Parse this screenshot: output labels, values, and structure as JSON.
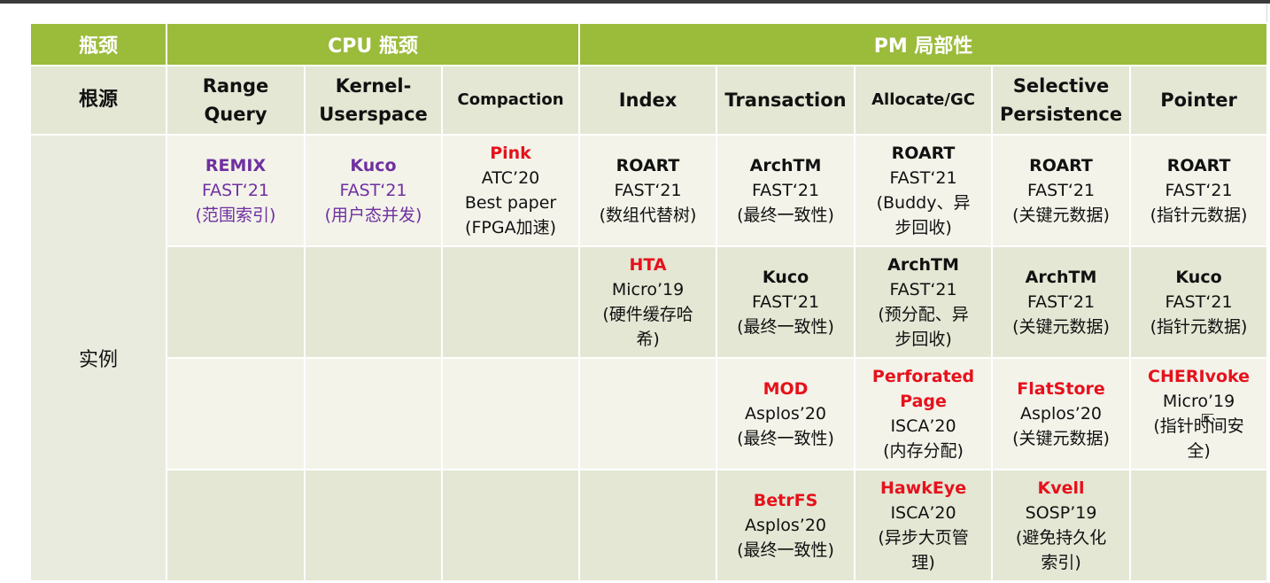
{
  "header": {
    "col0": "瓶颈",
    "cpu": "CPU 瓶颈",
    "pm": "PM 局部性"
  },
  "subheader": {
    "root": "根源",
    "range_query": [
      "Range",
      "Query"
    ],
    "kernel_userspace": [
      "Kernel-",
      "Userspace"
    ],
    "compaction": "Compaction",
    "index": "Index",
    "transaction": "Transaction",
    "allocate_gc": "Allocate/GC",
    "selective_persistence": [
      "Selective",
      "Persistence"
    ],
    "pointer": "Pointer"
  },
  "row_label": "实例",
  "rows": [
    [
      {
        "name": "REMIX",
        "lines": [
          "FAST‘21",
          "(范围索引)"
        ],
        "color": "purple"
      },
      {
        "name": "Kuco",
        "lines": [
          "FAST‘21",
          "(用户态并发)"
        ],
        "color": "purple"
      },
      {
        "name": "Pink",
        "lines": [
          "ATC’20",
          "Best paper",
          "(FPGA加速)"
        ],
        "color": "red"
      },
      {
        "name": "ROART",
        "lines": [
          "FAST‘21",
          "(数组代替树)"
        ],
        "color": "black"
      },
      {
        "name": "ArchTM",
        "lines": [
          "FAST‘21",
          "(最终一致性)"
        ],
        "color": "black"
      },
      {
        "name": "ROART",
        "lines": [
          "FAST‘21",
          "(Buddy、异",
          "步回收)"
        ],
        "color": "black"
      },
      {
        "name": "ROART",
        "lines": [
          "FAST‘21",
          "(关键元数据)"
        ],
        "color": "black"
      },
      {
        "name": "ROART",
        "lines": [
          "FAST‘21",
          "(指针元数据)"
        ],
        "color": "black"
      }
    ],
    [
      null,
      null,
      null,
      {
        "name": "HTA",
        "lines": [
          "Micro’19",
          "(硬件缓存哈",
          "希)"
        ],
        "color": "red"
      },
      {
        "name": "Kuco",
        "lines": [
          "FAST‘21",
          "(最终一致性)"
        ],
        "color": "black"
      },
      {
        "name": "ArchTM",
        "lines": [
          "FAST‘21",
          "(预分配、异",
          "步回收)"
        ],
        "color": "black"
      },
      {
        "name": "ArchTM",
        "lines": [
          "FAST‘21",
          "(关键元数据)"
        ],
        "color": "black"
      },
      {
        "name": "Kuco",
        "lines": [
          "FAST‘21",
          "(指针元数据)"
        ],
        "color": "black"
      }
    ],
    [
      null,
      null,
      null,
      null,
      {
        "name": "MOD",
        "lines": [
          "Asplos’20",
          "(最终一致性)"
        ],
        "color": "red"
      },
      {
        "name_lines": [
          "Perforated",
          "Page"
        ],
        "lines": [
          "ISCA’20",
          "(内存分配)"
        ],
        "color": "red"
      },
      {
        "name": "FlatStore",
        "lines": [
          "Asplos’20",
          "(关键元数据)"
        ],
        "color": "red"
      },
      {
        "name": "CHERIvoke",
        "lines": [
          "Micro’19",
          "(指针时间安",
          "全)"
        ],
        "color": "red"
      }
    ],
    [
      null,
      null,
      null,
      null,
      {
        "name": "BetrFS",
        "lines": [
          "Asplos’20",
          "(最终一致性)"
        ],
        "color": "red"
      },
      {
        "name": "HawkEye",
        "lines": [
          "ISCA’20",
          "(异步大页管",
          "理)"
        ],
        "color": "red"
      },
      {
        "name": "Kvell",
        "lines": [
          "SOSP’19",
          "(避免持久化",
          "索引)"
        ],
        "color": "red"
      },
      null
    ]
  ],
  "colors": {
    "header_green": "#9bbb3b",
    "sub_bg": "#e3e7d4",
    "row_light": "#f3f3ea",
    "accent_red": "#e6111c",
    "accent_purple": "#7030a0"
  }
}
